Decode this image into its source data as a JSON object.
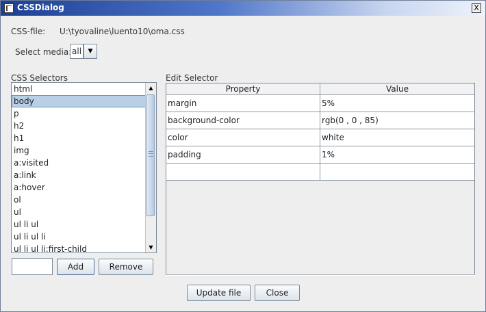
{
  "window": {
    "title": "CSSDialog",
    "close_glyph": "X",
    "icon": "app-icon"
  },
  "file_row": {
    "label": "CSS-file:",
    "path": "U:\\tyovaline\\luento10\\oma.css"
  },
  "media": {
    "label": "Select media:",
    "selected": "all"
  },
  "selectors": {
    "header": "CSS Selectors",
    "items": [
      "html",
      "body",
      "p",
      "h2",
      "h1",
      "img",
      "a:visited",
      "a:link",
      "a:hover",
      "ol",
      "ul",
      "ul li ul",
      "ul li ul li",
      "ul li ul li:first-child"
    ],
    "selected": "body",
    "new_selector_value": "",
    "add_label": "Add",
    "remove_label": "Remove"
  },
  "editor": {
    "header": "Edit Selector",
    "columns": [
      "Property",
      "Value"
    ],
    "rows": [
      {
        "property": "margin",
        "value": "5%"
      },
      {
        "property": "background-color",
        "value": "rgb(0 , 0 , 85)"
      },
      {
        "property": "color",
        "value": "white"
      },
      {
        "property": "padding",
        "value": "1%"
      },
      {
        "property": "",
        "value": ""
      }
    ]
  },
  "footer": {
    "update_label": "Update file",
    "close_label": "Close"
  }
}
